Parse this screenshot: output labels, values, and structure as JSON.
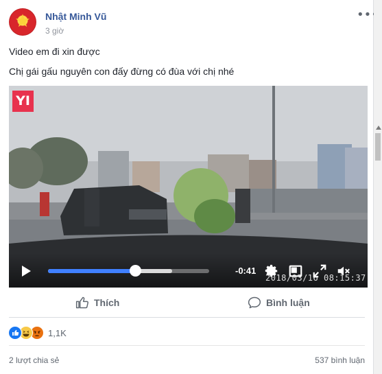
{
  "post": {
    "author": "Nhật Minh Vũ",
    "time": "3 giờ",
    "lines": [
      "Video em đi xin được",
      "Chị gái gấu nguyên con đấy đừng có đùa với chị nhé"
    ]
  },
  "video": {
    "logo": "YI",
    "time_remaining": "-0:41",
    "timestamp_overlay": "2018/03/16  08:15:37",
    "progress": 0.54,
    "buffered": 0.77,
    "controls": [
      "play-icon",
      "settings-gear-icon",
      "picture-in-picture-icon",
      "fullscreen-icon",
      "volume-muted-icon"
    ]
  },
  "actions": {
    "like_label": "Thích",
    "comment_label": "Bình luận"
  },
  "reactions": {
    "icons": [
      "like-reaction-icon",
      "haha-reaction-icon",
      "angry-reaction-icon"
    ],
    "count": "1,1K"
  },
  "footer": {
    "shares": "2 lượt chia sẻ",
    "comments": "537 bình luận"
  },
  "colors": {
    "link": "#365899",
    "progress": "#4080ff",
    "like_blue": "#1877f2",
    "logo_red": "#e8324e"
  }
}
